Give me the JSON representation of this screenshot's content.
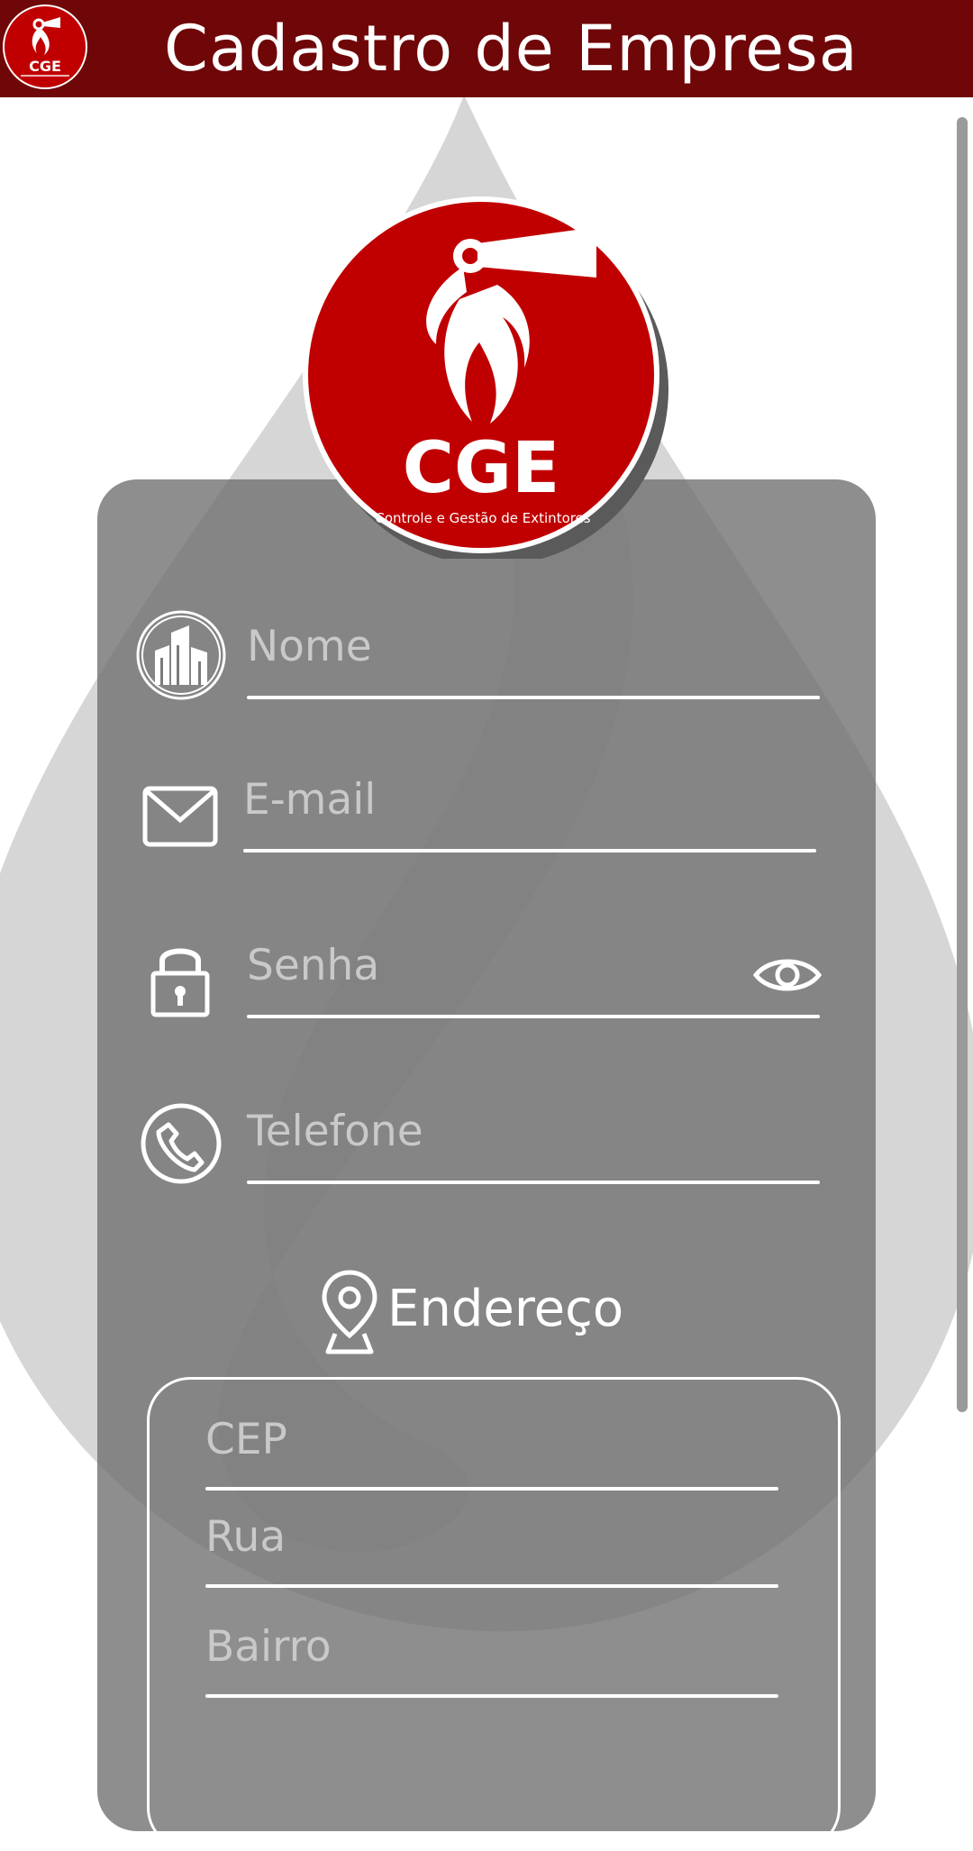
{
  "header": {
    "title": "Cadastro de Empresa",
    "logo_icon": "cge-extinguisher-logo"
  },
  "logo": {
    "brand": "CGE",
    "tagline": "Controle e Gestão de Extintores"
  },
  "form": {
    "nome_placeholder": "Nome",
    "email_placeholder": "E-mail",
    "senha_placeholder": "Senha",
    "telefone_placeholder": "Telefone"
  },
  "endereco": {
    "title": "Endereço",
    "cep_placeholder": "CEP",
    "rua_placeholder": "Rua",
    "bairro_placeholder": "Bairro"
  },
  "icons": {
    "nome": "buildings-icon",
    "email": "envelope-icon",
    "senha": "padlock-icon",
    "toggle": "eye-icon",
    "telefone": "phone-icon",
    "endereco": "map-pin-icon"
  },
  "colors": {
    "header": "#6f0608",
    "logo_red": "#c00000",
    "card": "#7b7b7b",
    "placeholder": "#c9c9c9"
  }
}
